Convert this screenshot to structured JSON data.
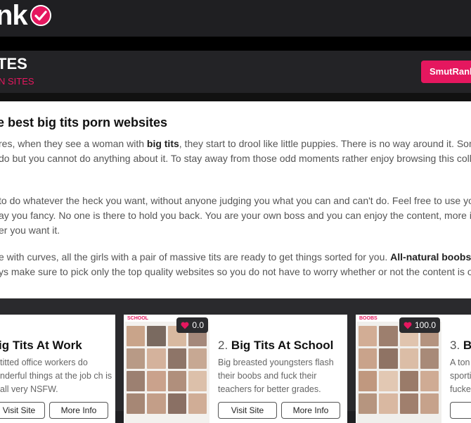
{
  "header": {
    "logo_text": "nk"
  },
  "banner": {
    "title": "TES",
    "subtitle": "N SITES",
    "button_label": "SmutRank"
  },
  "intro": {
    "heading": "e best big tits porn websites",
    "p1_line1_a": "res, when they see a woman with ",
    "p1_line1_bold": "big tits",
    "p1_line1_b": ", they start to drool like little puppies. There is no way around it. Some g",
    "p1_line2": "do but you cannot do anything about it. To stay away from those odd moments rather enjoy browsing this collect",
    "p2_line1": "to do whatever the heck you want, without anyone judging you what you can and can't do. Feel free to use your",
    "p2_line2": "ay you fancy. No one is there to hold you back. You are your own boss and you can enjoy the content, more impor",
    "p2_line3": "er you want it.",
    "p3_line1_a": "e with curves, all the girls with a pair of massive tits are ready to get things sorted for you. ",
    "p3_line1_bold": "All-natural boobs",
    "p3_line1_b": " an",
    "p3_line2": "ys make sure to pick only the top quality websites so you do not have to worry whether or not the content is of th"
  },
  "cards": [
    {
      "title": "ig Tits At Work",
      "desc": "titted office workers do nderful things at the job ch is all very NSFW.",
      "visit_label": "Visit Site",
      "more_label": "More Info"
    },
    {
      "score": "0.0",
      "brand": "SCHOOL",
      "number": "2.",
      "title": "Big Tits At School",
      "desc": "Big breasted youngsters flash their boobs and fuck their teachers for better grades.",
      "visit_label": "Visit Site",
      "more_label": "More Info"
    },
    {
      "score": "100.0",
      "brand": "BOOBS",
      "number": "3.",
      "title": "Ba",
      "desc": "A ton sporti fucke",
      "visit_label": "Vi"
    }
  ],
  "colors": {
    "accent": "#e5175f",
    "header_bg": "#1f1f22"
  }
}
